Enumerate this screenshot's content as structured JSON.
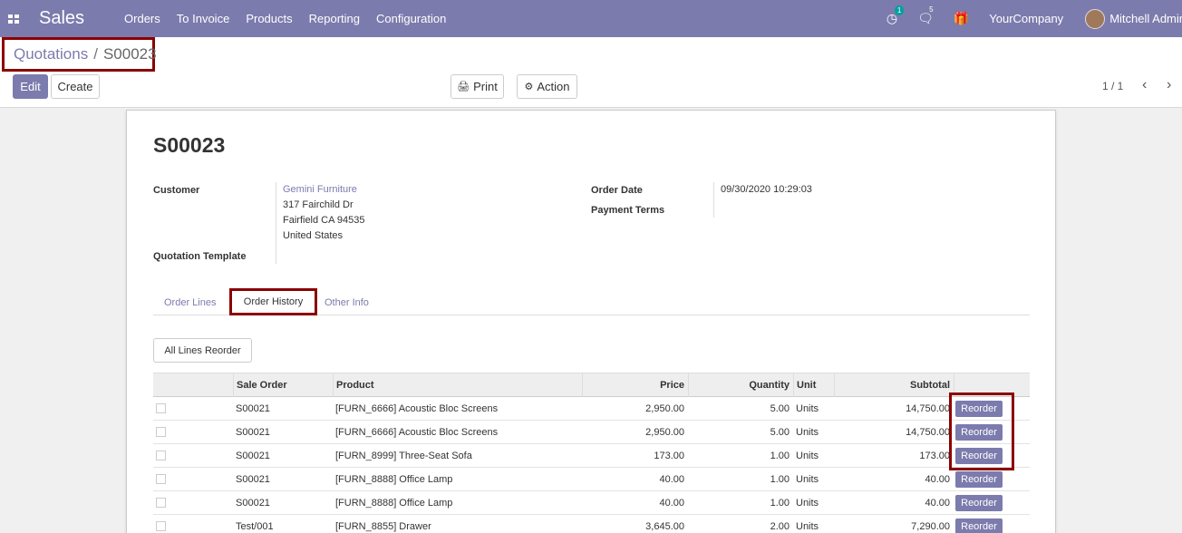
{
  "navbar": {
    "apps_icon": "apps-grid-icon",
    "brand": "Sales",
    "menu": [
      "Orders",
      "To Invoice",
      "Products",
      "Reporting",
      "Configuration"
    ],
    "activity_badge": "1",
    "messages_count": "5",
    "company": "YourCompany",
    "user": "Mitchell Admin"
  },
  "control_panel": {
    "breadcrumb_parent": "Quotations",
    "breadcrumb_separator": "/",
    "breadcrumb_current": "S00023",
    "edit_label": "Edit",
    "create_label": "Create",
    "print_label": "Print",
    "action_label": "Action",
    "pager": "1 / 1"
  },
  "form": {
    "name": "S00023",
    "customer_label": "Customer",
    "customer_name": "Gemini Furniture",
    "customer_address_1": "317 Fairchild Dr",
    "customer_address_2": "Fairfield CA 94535",
    "customer_address_3": "United States",
    "quotation_template_label": "Quotation Template",
    "order_date_label": "Order Date",
    "order_date": "09/30/2020 10:29:03",
    "payment_terms_label": "Payment Terms"
  },
  "tabs": {
    "order_lines": "Order Lines",
    "order_history": "Order History",
    "other_info": "Other Info"
  },
  "history": {
    "all_lines_reorder": "All Lines Reorder",
    "columns": {
      "sale_order": "Sale Order",
      "product": "Product",
      "price": "Price",
      "quantity": "Quantity",
      "unit": "Unit",
      "subtotal": "Subtotal"
    },
    "reorder_label": "Reorder",
    "rows": [
      {
        "sale_order": "S00021",
        "product": "[FURN_6666] Acoustic Bloc Screens",
        "price": "2,950.00",
        "quantity": "5.00",
        "unit": "Units",
        "subtotal": "14,750.00"
      },
      {
        "sale_order": "S00021",
        "product": "[FURN_6666] Acoustic Bloc Screens",
        "price": "2,950.00",
        "quantity": "5.00",
        "unit": "Units",
        "subtotal": "14,750.00"
      },
      {
        "sale_order": "S00021",
        "product": "[FURN_8999] Three-Seat Sofa",
        "price": "173.00",
        "quantity": "1.00",
        "unit": "Units",
        "subtotal": "173.00"
      },
      {
        "sale_order": "S00021",
        "product": "[FURN_8888] Office Lamp",
        "price": "40.00",
        "quantity": "1.00",
        "unit": "Units",
        "subtotal": "40.00"
      },
      {
        "sale_order": "S00021",
        "product": "[FURN_8888] Office Lamp",
        "price": "40.00",
        "quantity": "1.00",
        "unit": "Units",
        "subtotal": "40.00"
      },
      {
        "sale_order": "Test/001",
        "product": "[FURN_8855] Drawer",
        "price": "3,645.00",
        "quantity": "2.00",
        "unit": "Units",
        "subtotal": "7,290.00"
      }
    ]
  }
}
